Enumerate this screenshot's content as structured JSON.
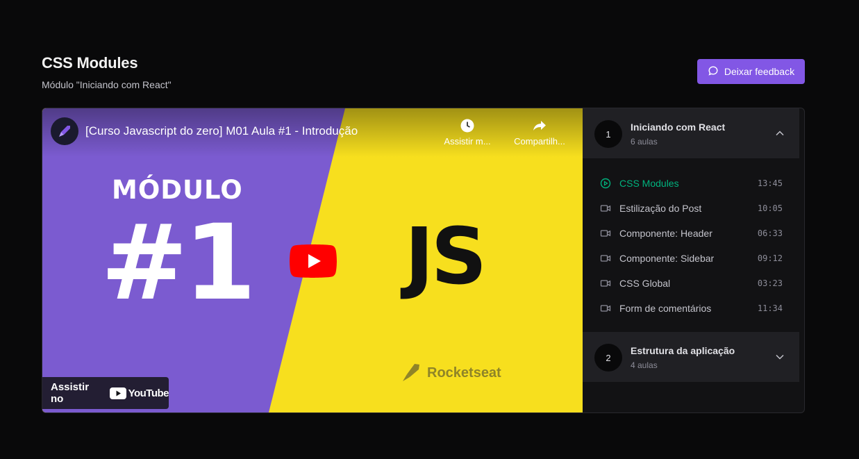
{
  "header": {
    "title": "CSS Modules",
    "subtitle": "Módulo \"Iniciando com React\"",
    "feedback_label": "Deixar feedback",
    "feedback_icon": "chat-bubble-icon"
  },
  "video": {
    "title": "[Curso Javascript do zero] M01 Aula #1 - Introdução",
    "watch_later_label": "Assistir m...",
    "share_label": "Compartilh...",
    "thumbnail_module_text": "MÓDULO",
    "thumbnail_number": "#1",
    "thumbnail_js": "JS",
    "brand": "Rocketseat",
    "watch_on_label": "Assistir no",
    "youtube_label": "YouTube",
    "colors": {
      "purple": "#7b5bd0",
      "yellow": "#f7df1e"
    }
  },
  "sidebar": {
    "modules": [
      {
        "number": "1",
        "title": "Iniciando com React",
        "count": "6 aulas",
        "expanded": true
      },
      {
        "number": "2",
        "title": "Estrutura da aplicação",
        "count": "4 aulas",
        "expanded": false
      }
    ],
    "lessons": [
      {
        "title": "CSS Modules",
        "time": "13:45",
        "active": true,
        "icon": "play-circle-icon"
      },
      {
        "title": "Estilização do Post",
        "time": "10:05",
        "active": false,
        "icon": "video-camera-icon"
      },
      {
        "title": "Componente: Header",
        "time": "06:33",
        "active": false,
        "icon": "video-camera-icon"
      },
      {
        "title": "Componente: Sidebar",
        "time": "09:12",
        "active": false,
        "icon": "video-camera-icon"
      },
      {
        "title": "CSS Global",
        "time": "03:23",
        "active": false,
        "icon": "video-camera-icon"
      },
      {
        "title": "Form de comentários",
        "time": "11:34",
        "active": false,
        "icon": "video-camera-icon"
      }
    ]
  },
  "colors": {
    "accent": "#8257e5",
    "active_lesson": "#00b37e",
    "background": "#09090a"
  }
}
